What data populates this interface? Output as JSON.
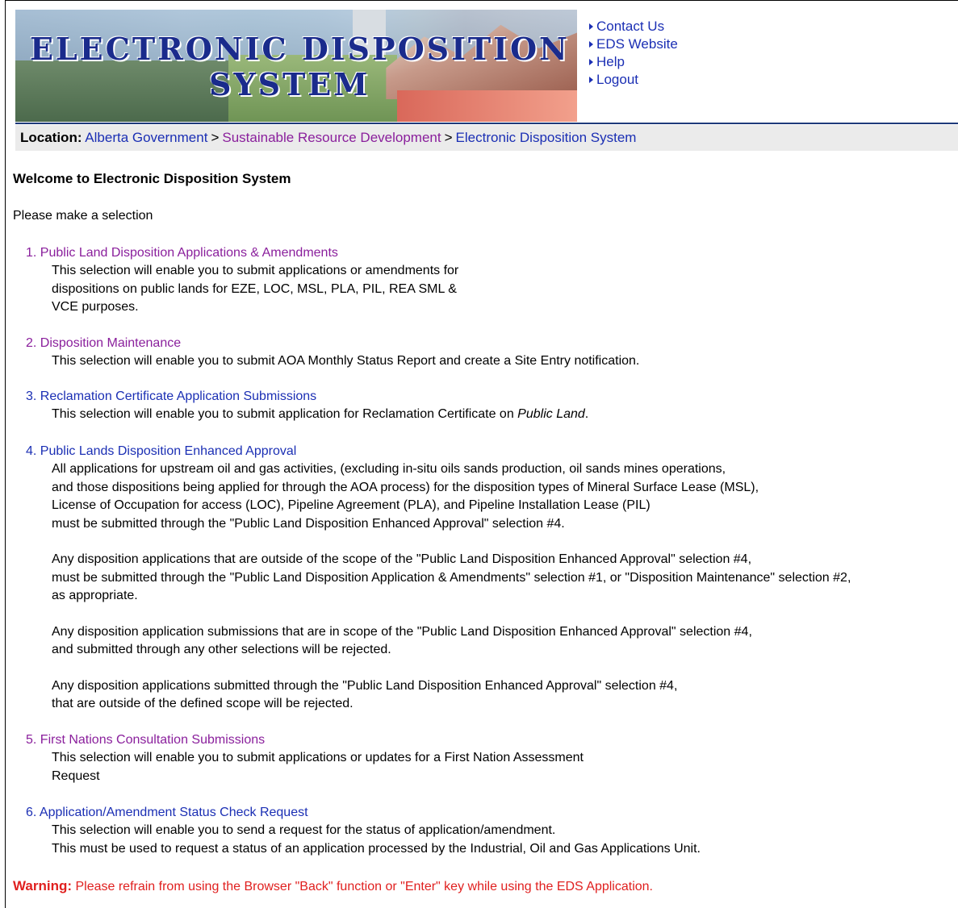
{
  "banner": {
    "line1": "ELECTRONIC DISPOSITION",
    "line2": "SYSTEM"
  },
  "toplinks": [
    "Contact Us",
    "EDS Website",
    "Help",
    "Logout"
  ],
  "location": {
    "label": "Location:",
    "crumbs": [
      "Alberta Government",
      "Sustainable Resource Development",
      "Electronic Disposition System"
    ],
    "separator": ">"
  },
  "welcome": "Welcome to Electronic Disposition System",
  "please": "Please make a selection",
  "selections": [
    {
      "title": "1. Public Land Disposition Applications & Amendments",
      "desc": [
        "This selection will enable you to submit applications or amendments for",
        "dispositions on public lands for EZE, LOC, MSL, PLA, PIL, REA SML &",
        "VCE purposes."
      ]
    },
    {
      "title": "2. Disposition Maintenance",
      "desc": [
        "This selection will enable you to submit AOA Monthly Status Report and create a Site Entry notification."
      ]
    },
    {
      "title": "3. Reclamation Certificate Application Submissions",
      "desc_prefix": "This selection will enable you to submit application for Reclamation Certificate on ",
      "desc_em": "Public Land",
      "desc_suffix": "."
    },
    {
      "title": "4. Public Lands Disposition Enhanced Approval",
      "paragraphs": [
        [
          "All applications for upstream oil and gas activities, (excluding in-situ oils sands production, oil sands mines operations,",
          "and those dispositions being applied for through the AOA process) for the disposition types of Mineral Surface Lease (MSL),",
          "License of Occupation for access (LOC), Pipeline Agreement (PLA), and Pipeline Installation Lease (PIL)",
          "must be submitted through the \"Public Land Disposition Enhanced Approval\" selection #4."
        ],
        [
          "Any disposition applications that are outside of the scope of the \"Public Land Disposition Enhanced Approval\" selection #4,",
          "must be submitted through the \"Public Land Disposition Application & Amendments\" selection #1, or \"Disposition Maintenance\" selection #2,",
          "as appropriate."
        ],
        [
          "Any disposition application submissions that are in scope of the \"Public Land Disposition Enhanced Approval\" selection #4,",
          "and submitted through any other selections will be rejected."
        ],
        [
          "Any disposition applications submitted through the \"Public Land Disposition Enhanced Approval\" selection #4,",
          "that are outside of the defined scope will be rejected."
        ]
      ]
    },
    {
      "title": "5. First Nations Consultation Submissions",
      "desc": [
        "This selection will enable you to submit applications or updates for a First Nation Assessment",
        "Request"
      ]
    },
    {
      "title": "6. Application/Amendment Status Check Request",
      "desc": [
        "This selection will enable you to send a request for the status of application/amendment.",
        "This must be used to request a status of an application processed by the Industrial, Oil and Gas Applications Unit."
      ]
    }
  ],
  "warning": {
    "label": "Warning:",
    "text": "Please refrain from using the Browser \"Back\" function or \"Enter\" key while using the EDS Application."
  },
  "colors": {
    "link_blue": "#1b2fb4",
    "link_visited": "#8a1f9c",
    "warning": "#e0201f",
    "loc_bar": "#ebebeb"
  }
}
